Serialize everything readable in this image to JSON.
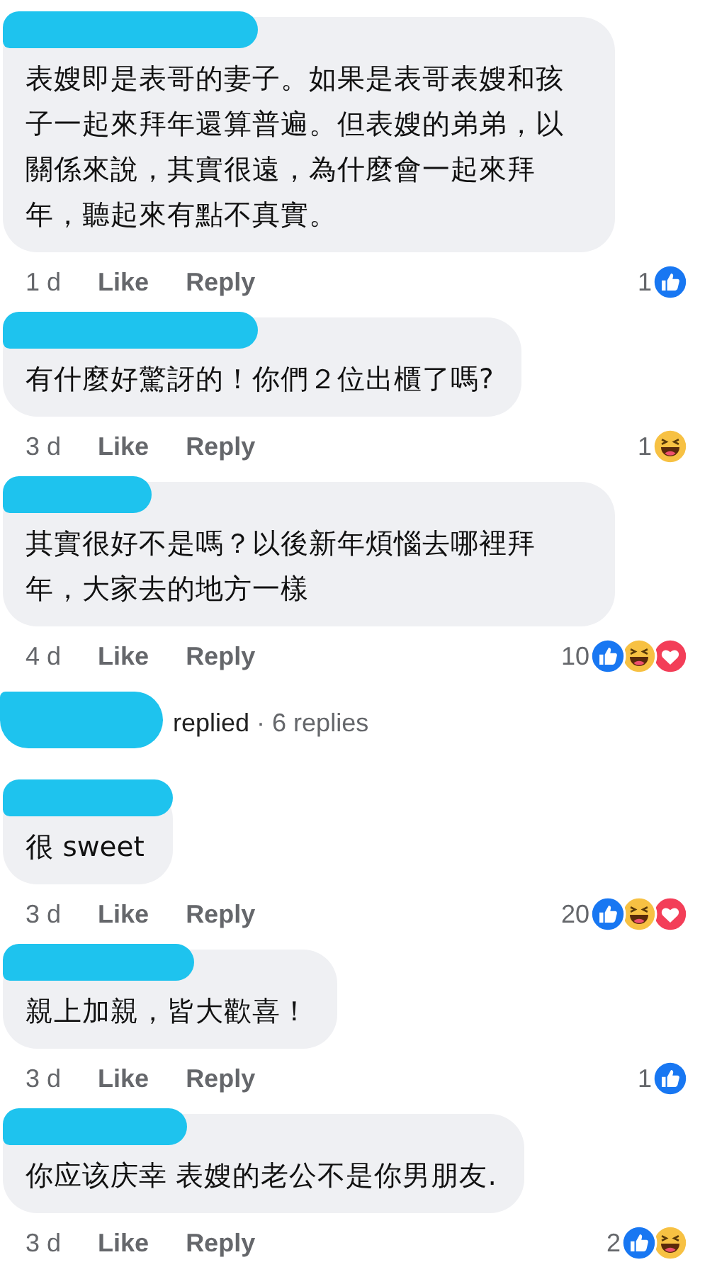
{
  "thread": [
    {
      "kind": "comment",
      "text": "表嫂即是表哥的妻子。如果是表哥表嫂和孩子一起來拜年還算普遍。但表嫂的弟弟，以關係來說，其實很遠，為什麼會一起來拜年，聽起來有點不真實。",
      "time": "1 d",
      "like": "Like",
      "reply": "Reply",
      "reaction_count": "1",
      "reactions": [
        {
          "kind": "like"
        }
      ]
    },
    {
      "kind": "comment",
      "text": "有什麼好驚訝的！你們２位出櫃了嗎?",
      "time": "3 d",
      "like": "Like",
      "reply": "Reply",
      "reaction_count": "1",
      "reactions": [
        {
          "kind": "haha"
        }
      ]
    },
    {
      "kind": "comment",
      "text": "其實很好不是嗎？以後新年煩惱去哪裡拜年，大家去的地方一樣",
      "time": "4 d",
      "like": "Like",
      "reply": "Reply",
      "reaction_count": "10",
      "reactions": [
        {
          "kind": "like"
        },
        {
          "kind": "haha"
        },
        {
          "kind": "love"
        }
      ]
    },
    {
      "kind": "replies",
      "text": "**replied** · 6 replies"
    },
    {
      "kind": "comment",
      "text": "很 sweet",
      "time": "3 d",
      "like": "Like",
      "reply": "Reply",
      "reaction_count": "20",
      "reactions": [
        {
          "kind": "like"
        },
        {
          "kind": "haha"
        },
        {
          "kind": "love"
        }
      ]
    },
    {
      "kind": "comment",
      "text": "親上加親，皆大歡喜！",
      "time": "3 d",
      "like": "Like",
      "reply": "Reply",
      "reaction_count": "1",
      "reactions": [
        {
          "kind": "like"
        }
      ]
    },
    {
      "kind": "comment",
      "text": "你应该庆幸 表嫂的老公不是你男朋友.",
      "time": "3 d",
      "like": "Like",
      "reply": "Reply",
      "reaction_count": "2",
      "reactions": [
        {
          "kind": "like"
        },
        {
          "kind": "haha"
        }
      ]
    }
  ]
}
